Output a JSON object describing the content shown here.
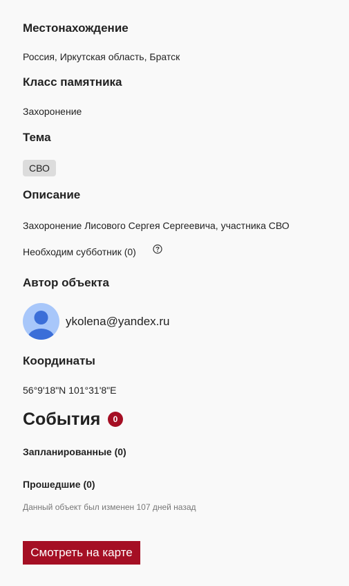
{
  "location": {
    "heading": "Местонахождение",
    "value": "Россия, Иркутская область, Братск"
  },
  "monument_class": {
    "heading": "Класс памятника",
    "value": "Захоронение"
  },
  "theme": {
    "heading": "Тема",
    "tag": "СВО"
  },
  "description": {
    "heading": "Описание",
    "value": "Захоронение Лисового Сергея Сергеевича, участника СВО",
    "subbotnik": "Необходим субботник (0)"
  },
  "author": {
    "heading": "Автор объекта",
    "email": "ykolena@yandex.ru"
  },
  "coordinates": {
    "heading": "Координаты",
    "value": "56°9'18\"N 101°31'8\"E"
  },
  "events": {
    "title": "События",
    "count": "0",
    "planned": "Запланированные (0)",
    "past": "Прошедшие (0)"
  },
  "modified_note": "Данный объект был изменен 107 дней назад",
  "map_button": "Смотреть на карте",
  "colors": {
    "accent": "#a50f24",
    "tag_bg": "#dcdcdc",
    "avatar_bg": "#a8c7fa",
    "avatar_fg": "#3b6ed8"
  }
}
